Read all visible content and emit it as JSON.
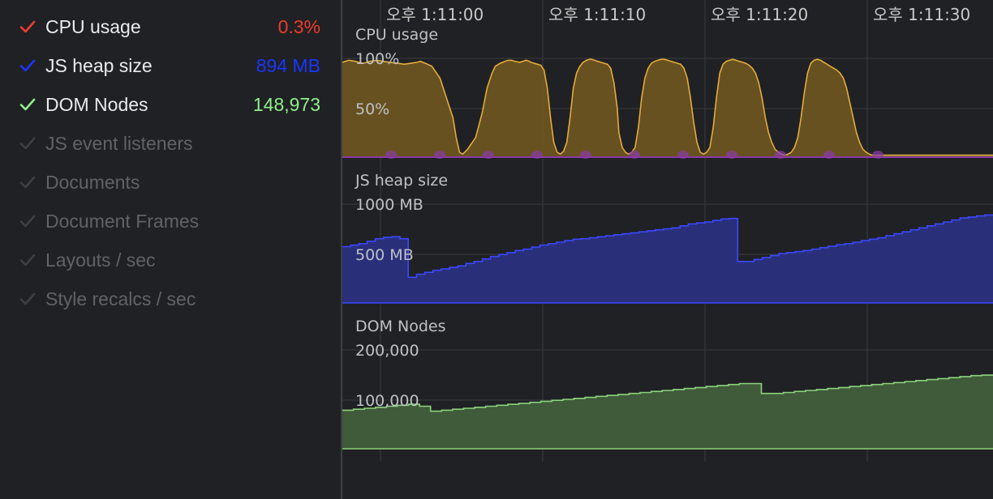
{
  "colors": {
    "cpu": "#ee3b2c",
    "heap": "#1a35ff",
    "dom": "#8ef08a",
    "cpu_fill": "#6b5422",
    "cpu_line": "#e4ab3b",
    "purple": "#8a3aa8",
    "heap_fill": "#2a2f7a",
    "heap_line": "#3a48ff",
    "dom_fill": "#3f5b39",
    "dom_line": "#8bd37d",
    "grid": "#3a3b3e"
  },
  "metrics": [
    {
      "label": "CPU usage",
      "value": "0.3%",
      "checked": true,
      "color": "#ee3b2c"
    },
    {
      "label": "JS heap size",
      "value": "894 MB",
      "checked": true,
      "color": "#1a35ff"
    },
    {
      "label": "DOM Nodes",
      "value": "148,973",
      "checked": true,
      "color": "#8ef08a"
    },
    {
      "label": "JS event listeners",
      "value": "",
      "checked": false,
      "color": "#3c4043"
    },
    {
      "label": "Documents",
      "value": "",
      "checked": false,
      "color": "#3c4043"
    },
    {
      "label": "Document Frames",
      "value": "",
      "checked": false,
      "color": "#3c4043"
    },
    {
      "label": "Layouts / sec",
      "value": "",
      "checked": false,
      "color": "#3c4043"
    },
    {
      "label": "Style recalcs / sec",
      "value": "",
      "checked": false,
      "color": "#3c4043"
    }
  ],
  "time_labels": [
    "오후 1:11:00",
    "오후 1:11:10",
    "오후 1:11:20",
    "오후 1:11:30"
  ],
  "charts": {
    "cpu": {
      "title": "CPU usage",
      "ticks": [
        "100%",
        "50%"
      ]
    },
    "heap": {
      "title": "JS heap size",
      "ticks": [
        "1000 MB",
        "500 MB"
      ]
    },
    "dom": {
      "title": "DOM Nodes",
      "ticks": [
        "200,000",
        "100,000"
      ]
    }
  },
  "chart_data": [
    {
      "type": "area",
      "title": "CPU usage",
      "x": [
        "오후 1:11:00",
        "오후 1:11:10",
        "오후 1:11:20",
        "오후 1:11:30"
      ],
      "ylim": [
        0,
        100
      ],
      "yticks": [
        "100%",
        "50%"
      ],
      "series": [
        {
          "name": "CPU usage",
          "x": [
            0,
            4,
            8,
            10,
            13,
            17,
            21,
            25,
            29,
            34,
            38,
            42,
            46,
            48,
            51,
            55,
            60,
            64,
            68,
            70,
            72,
            74,
            77,
            82,
            86,
            89,
            92,
            94,
            97,
            100,
            102,
            104,
            106,
            109,
            111,
            113,
            115,
            116,
            118,
            120,
            122,
            124,
            126,
            128,
            130,
            132,
            134,
            136,
            138,
            140,
            142,
            144,
            146,
            148,
            150,
            152,
            153,
            155,
            157,
            159,
            161,
            163,
            165,
            167,
            169,
            170,
            172,
            174,
            176,
            178,
            180,
            182,
            184,
            186,
            188,
            190,
            192,
            194,
            196,
            198,
            200,
            202,
            204,
            206,
            208,
            210,
            212,
            214,
            216,
            218,
            220,
            222,
            224,
            226,
            228,
            230,
            232,
            234,
            236,
            238,
            240,
            242,
            244,
            246,
            248,
            250,
            252,
            254,
            256,
            258,
            260,
            262,
            264,
            266,
            268,
            270,
            272,
            274,
            276,
            278,
            280,
            282,
            284,
            286,
            288,
            290,
            292,
            294,
            296,
            298,
            300,
            302,
            304,
            306,
            308,
            310,
            312,
            314,
            316,
            318,
            320,
            322,
            324,
            326,
            328,
            330,
            332,
            334,
            336,
            338,
            340,
            342,
            344,
            346,
            348,
            350,
            352,
            354,
            356,
            358,
            360,
            362,
            364,
            366,
            368,
            370,
            372,
            374,
            376,
            378,
            380,
            382,
            384,
            386,
            388,
            390,
            392,
            394,
            396,
            398,
            400
          ],
          "values": [
            96,
            98,
            97,
            96,
            95,
            97,
            98,
            97,
            96,
            95,
            94,
            95,
            96,
            97,
            95,
            92,
            80,
            60,
            40,
            20,
            5,
            3,
            8,
            20,
            45,
            70,
            85,
            92,
            95,
            97,
            98,
            98,
            97,
            96,
            97,
            98,
            97,
            96,
            95,
            94,
            93,
            88,
            70,
            40,
            15,
            5,
            3,
            6,
            15,
            40,
            70,
            85,
            92,
            96,
            98,
            99,
            99,
            98,
            97,
            96,
            95,
            94,
            90,
            75,
            50,
            25,
            10,
            5,
            3,
            5,
            10,
            30,
            60,
            80,
            90,
            95,
            97,
            98,
            99,
            99,
            98,
            97,
            96,
            95,
            94,
            90,
            80,
            60,
            35,
            15,
            5,
            3,
            5,
            10,
            30,
            60,
            85,
            94,
            97,
            98,
            99,
            98,
            97,
            96,
            95,
            93,
            90,
            85,
            75,
            60,
            40,
            25,
            15,
            8,
            5,
            3,
            2,
            3,
            5,
            10,
            20,
            40,
            65,
            85,
            95,
            98,
            99,
            98,
            96,
            94,
            92,
            90,
            88,
            85,
            80,
            70,
            55,
            40,
            25,
            15,
            8,
            5,
            3,
            2,
            2,
            2,
            2,
            2,
            2,
            2,
            2,
            2,
            2,
            2,
            2,
            2,
            2,
            2,
            2,
            2,
            2,
            2,
            2,
            2,
            2,
            2,
            2,
            2,
            2,
            2,
            2,
            2,
            2,
            2,
            2,
            2,
            2,
            2,
            2,
            2,
            2
          ]
        }
      ]
    },
    {
      "type": "line",
      "title": "JS heap size",
      "x": [
        "오후 1:11:00",
        "오후 1:11:10",
        "오후 1:11:20",
        "오후 1:11:30"
      ],
      "ylim": [
        0,
        1000
      ],
      "yticks": [
        "1000 MB",
        "500 MB"
      ],
      "series": [
        {
          "name": "JS heap size",
          "values": [
            570,
            585,
            600,
            625,
            650,
            665,
            670,
            650,
            260,
            290,
            310,
            330,
            345,
            360,
            375,
            400,
            420,
            445,
            470,
            490,
            510,
            530,
            545,
            565,
            585,
            600,
            615,
            630,
            645,
            650,
            660,
            670,
            680,
            690,
            700,
            710,
            720,
            730,
            740,
            750,
            760,
            780,
            800,
            810,
            820,
            835,
            850,
            855,
            420,
            420,
            440,
            460,
            480,
            500,
            510,
            520,
            530,
            545,
            560,
            575,
            590,
            600,
            615,
            630,
            645,
            660,
            680,
            700,
            720,
            740,
            760,
            780,
            800,
            820,
            840,
            860,
            870,
            880,
            890,
            894
          ]
        }
      ]
    },
    {
      "type": "line",
      "title": "DOM Nodes",
      "x": [
        "오후 1:11:00",
        "오후 1:11:10",
        "오후 1:11:20",
        "오후 1:11:30"
      ],
      "ylim": [
        0,
        200000
      ],
      "yticks": [
        "200,000",
        "100,000"
      ],
      "series": [
        {
          "name": "DOM Nodes",
          "values": [
            78000,
            80000,
            82000,
            84000,
            86000,
            88000,
            90000,
            86000,
            76000,
            78000,
            80000,
            82000,
            84000,
            86000,
            88000,
            90000,
            92000,
            94000,
            96000,
            98000,
            100000,
            102000,
            104000,
            106000,
            108000,
            110000,
            112000,
            114000,
            116000,
            118000,
            120000,
            122000,
            124000,
            126000,
            128000,
            130000,
            132000,
            132000,
            112000,
            112000,
            114000,
            116000,
            118000,
            120000,
            122000,
            124000,
            126000,
            128000,
            130000,
            132000,
            134000,
            136000,
            138000,
            140000,
            142000,
            144000,
            146000,
            148000,
            148973,
            148973
          ]
        }
      ]
    }
  ]
}
